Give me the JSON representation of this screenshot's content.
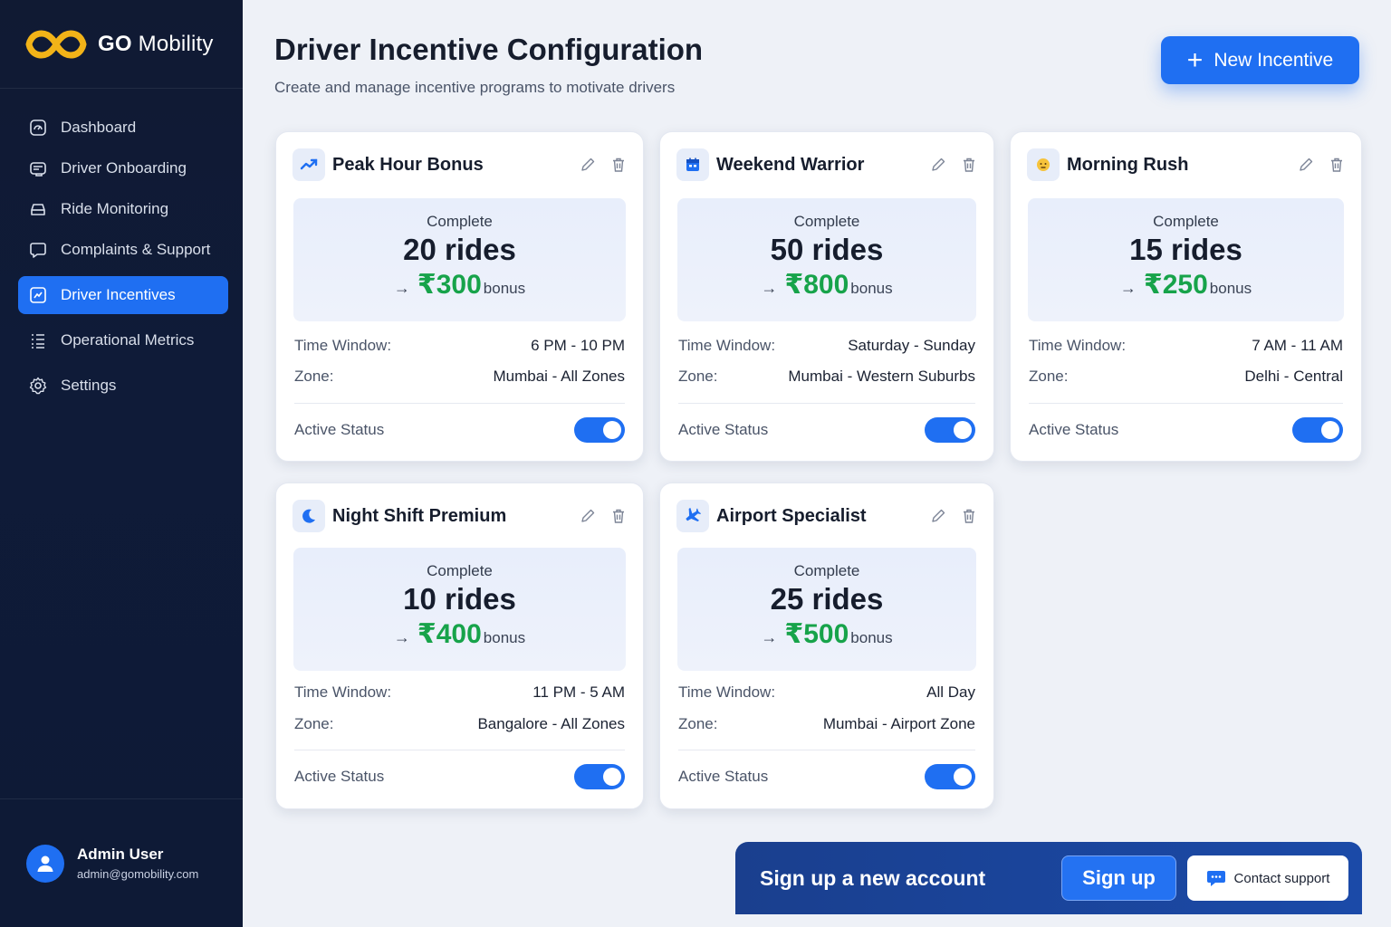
{
  "brand": {
    "name_bold": "GO",
    "name_rest": "Mobility"
  },
  "sidebar": {
    "items": [
      {
        "label": "Dashboard",
        "icon": "dashboard-icon",
        "active": false
      },
      {
        "label": "Driver Onboarding",
        "icon": "id-card-icon",
        "active": false
      },
      {
        "label": "Ride Monitoring",
        "icon": "car-icon",
        "active": false
      },
      {
        "label": "Complaints & Support",
        "icon": "chat-bubble-icon",
        "active": false
      },
      {
        "label": "Driver Incentives",
        "icon": "chart-square-icon",
        "active": true
      },
      {
        "label": "Operational Metrics",
        "icon": "list-icon",
        "active": false
      },
      {
        "label": "Settings",
        "icon": "gear-icon",
        "active": false
      }
    ],
    "user": {
      "name": "Admin User",
      "email": "admin@gomobility.com"
    }
  },
  "header": {
    "title": "Driver Incentive Configuration",
    "subtitle": "Create and manage incentive programs to motivate drivers",
    "new_button": "New Incentive"
  },
  "labels": {
    "complete": "Complete",
    "bonus": "bonus",
    "time_window": "Time Window:",
    "zone": "Zone:",
    "active_status": "Active Status"
  },
  "incentives": [
    {
      "title": "Peak Hour Bonus",
      "icon": "trending-up-icon",
      "rides": "20 rides",
      "bonus": "₹300",
      "time_window": "6 PM  -  10 PM",
      "zone": "Mumbai - All Zones",
      "active": true
    },
    {
      "title": "Weekend Warrior",
      "icon": "calendar-icon",
      "rides": "50 rides",
      "bonus": "₹800",
      "time_window": "Saturday - Sunday",
      "zone": "Mumbai - Western Suburbs",
      "active": true
    },
    {
      "title": "Morning Rush",
      "icon": "sun-face-icon",
      "rides": "15 rides",
      "bonus": "₹250",
      "time_window": "7 AM  -  11 AM",
      "zone": "Delhi - Central",
      "active": true
    },
    {
      "title": "Night Shift Premium",
      "icon": "moon-icon",
      "rides": "10 rides",
      "bonus": "₹400",
      "time_window": "11 PM  -  5 AM",
      "zone": "Bangalore - All Zones",
      "active": true
    },
    {
      "title": "Airport Specialist",
      "icon": "airplane-icon",
      "rides": "25 rides",
      "bonus": "₹500",
      "time_window": "All Day",
      "zone": "Mumbai - Airport Zone",
      "active": true
    }
  ],
  "banner": {
    "text": "Sign up a new account",
    "signup_button": "Sign up",
    "support_button": "Contact support"
  },
  "colors": {
    "accent": "#1f6ff2",
    "sidebar_bg": "#101a33",
    "bonus_green": "#17a34a",
    "logo_gold": "#f2b318"
  }
}
